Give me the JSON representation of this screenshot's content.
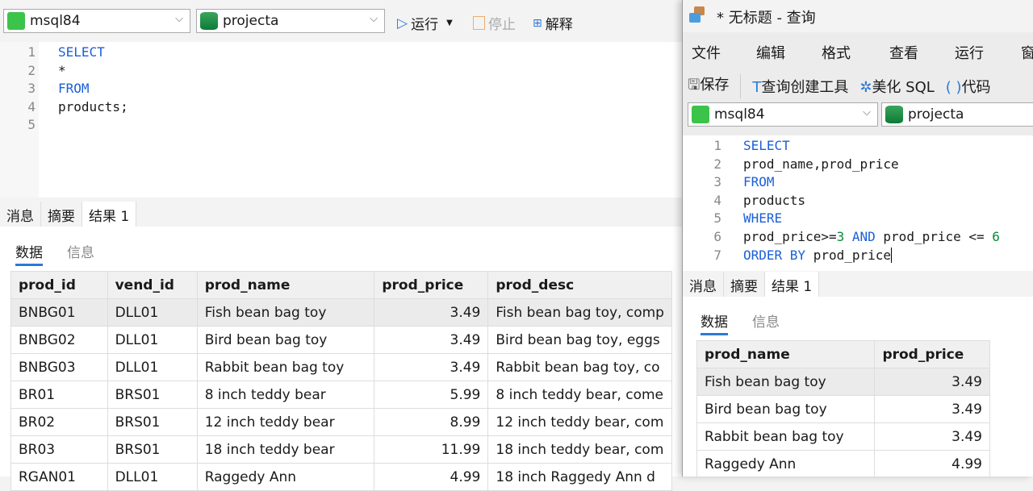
{
  "left": {
    "connection": "msql84",
    "database": "projecta",
    "run": "运行",
    "stop": "停止",
    "explain": "解释",
    "lines": [
      "1",
      "2",
      "3",
      "4",
      "5"
    ],
    "tabs": [
      "消息",
      "摘要",
      "结果 1"
    ],
    "subtabs": [
      "数据",
      "信息"
    ],
    "columns": [
      "prod_id",
      "vend_id",
      "prod_name",
      "prod_price",
      "prod_desc"
    ],
    "rows": [
      [
        "BNBG01",
        "DLL01",
        "Fish bean bag toy",
        "3.49",
        "Fish bean bag toy, comp"
      ],
      [
        "BNBG02",
        "DLL01",
        "Bird bean bag toy",
        "3.49",
        "Bird bean bag toy, eggs"
      ],
      [
        "BNBG03",
        "DLL01",
        "Rabbit bean bag toy",
        "3.49",
        "Rabbit bean bag toy, co"
      ],
      [
        "BR01",
        "BRS01",
        "8 inch teddy bear",
        "5.99",
        "8 inch teddy bear, come"
      ],
      [
        "BR02",
        "BRS01",
        "12 inch teddy bear",
        "8.99",
        "12 inch teddy bear, com"
      ],
      [
        "BR03",
        "BRS01",
        "18 inch teddy bear",
        "11.99",
        "18 inch teddy bear, com"
      ],
      [
        "RGAN01",
        "DLL01",
        "Raggedy Ann",
        "4.99",
        "18 inch Raggedy Ann d"
      ]
    ]
  },
  "right": {
    "title": "* 无标题 - 查询",
    "menu": [
      "文件",
      "编辑",
      "格式",
      "查看",
      "运行",
      "窗"
    ],
    "save": "保存",
    "builder": "查询创建工具",
    "beautify": "美化 SQL",
    "code": "代码",
    "connection": "msql84",
    "database": "projecta",
    "lines": [
      "1",
      "2",
      "3",
      "4",
      "5",
      "6",
      "7"
    ],
    "tabs": [
      "消息",
      "摘要",
      "结果 1"
    ],
    "subtabs": [
      "数据",
      "信息"
    ],
    "columns": [
      "prod_name",
      "prod_price"
    ],
    "rows": [
      [
        "Fish bean bag toy",
        "3.49"
      ],
      [
        "Bird bean bag toy",
        "3.49"
      ],
      [
        "Rabbit bean bag toy",
        "3.49"
      ],
      [
        "Raggedy Ann",
        "4.99"
      ]
    ]
  }
}
